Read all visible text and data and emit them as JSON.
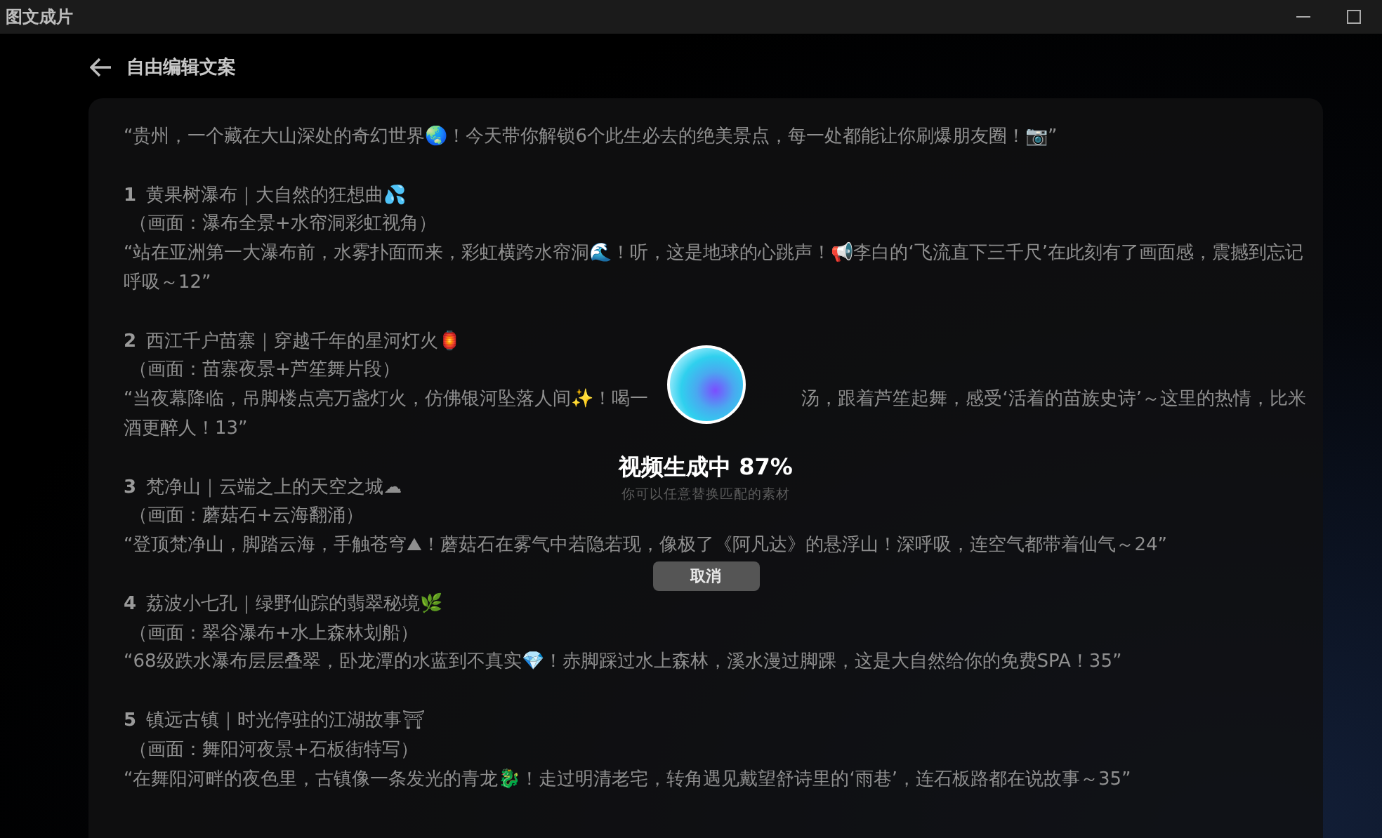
{
  "window": {
    "title": "图文成片"
  },
  "header": {
    "title": "自由编辑文案"
  },
  "script": {
    "intro": "“贵州，一个藏在大山深处的奇幻世界🌏！今天带你解锁6个此生必去的绝美景点，每一处都能让你刷爆朋友圈！📷”",
    "sections": [
      {
        "number": "1",
        "title": "黄果树瀑布｜大自然的狂想曲💦",
        "scene": "（画面：瀑布全景+水帘洞彩虹视角）",
        "quote_lines": [
          [
            "“站在亚洲第一大瀑布前，水雾扑面而来，彩虹横跨水帘洞🌊！听，这是地球的心跳声！📢李白的‘飞流直下三千尺’在此刻有了画面感，震撼到忘记呼吸～12”"
          ]
        ]
      },
      {
        "number": "2",
        "title": "西江千户苗寨｜穿越千年的星河灯火🏮",
        "scene": "（画面：苗寨夜景+芦笙舞片段）",
        "quote_lines": [
          [
            "“当夜幕降临，吊脚楼点亮万盏灯火，仿佛银河坠落人间✨！喝一",
            "汤，跟着芦笙起舞，感受‘活着的苗族史诗’～这里的热情，比米"
          ],
          [
            "酒更醉人！13”"
          ]
        ]
      },
      {
        "number": "3",
        "title": "梵净山｜云端之上的天空之城☁",
        "scene": "（画面：蘑菇石+云海翻涌）",
        "quote_lines": [
          [
            "“登顶梵净山，脚踏云海，手触苍穹⛰！蘑菇石在雾气中若隐若现，像极了《阿凡达》的悬浮山！深呼吸，连空气都带着仙气～24”"
          ]
        ]
      },
      {
        "number": "4",
        "title": "荔波小七孔｜绿野仙踪的翡翠秘境🌿",
        "scene": "（画面：翠谷瀑布+水上森林划船）",
        "quote_lines": [
          [
            "“68级跌水瀑布层层叠翠，卧龙潭的水蓝到不真实💎！赤脚踩过水上森林，溪水漫过脚踝，这是大自然给你的免费SPA！35”"
          ]
        ]
      },
      {
        "number": "5",
        "title": "镇远古镇｜时光停驻的江湖故事⛩",
        "scene": "（画面：舞阳河夜景+石板街特写）",
        "quote_lines": [
          [
            "“在舞阳河畔的夜色里，古镇像一条发光的青龙🐉！走过明清老宅，转角遇见戴望舒诗里的‘雨巷’，连石板路都在说故事～35”"
          ]
        ]
      }
    ]
  },
  "progress": {
    "title": "视频生成中 87%",
    "hint": "你可以任意替换匹配的素材",
    "cancel": "取消"
  }
}
